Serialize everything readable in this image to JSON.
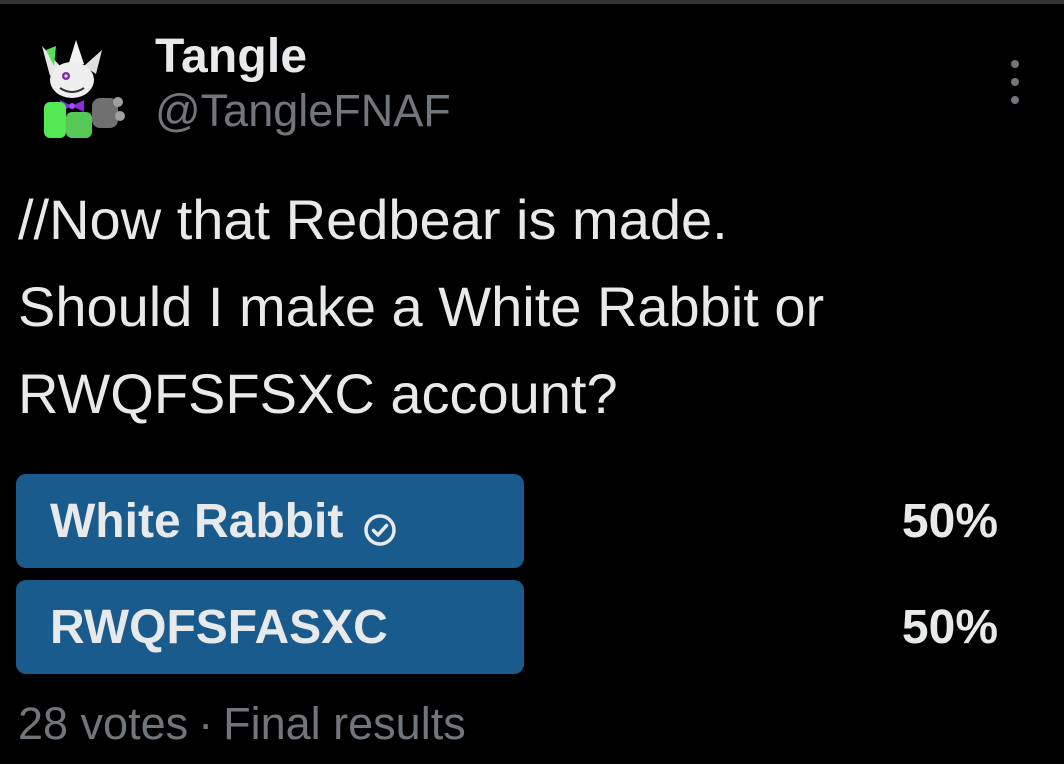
{
  "author": {
    "display_name": "Tangle",
    "handle": "@TangleFNAF",
    "avatar": "avatar-image"
  },
  "menu": {
    "icon": "more-vertical-icon"
  },
  "tweet": {
    "lines": [
      "//Now that Redbear is made.",
      "Should I make a White Rabbit or",
      "RWQFSFSXC account?"
    ]
  },
  "poll": {
    "options": [
      {
        "label": "White Rabbit",
        "percent": "50%",
        "fill": 0.5,
        "winner": true,
        "icon": "check-circle-icon"
      },
      {
        "label": "RWQFSFASXC",
        "percent": "50%",
        "fill": 0.5,
        "winner": false
      }
    ],
    "votes": "28 votes",
    "separator": "·",
    "status": "Final results"
  },
  "colors": {
    "background": "#000000",
    "text": "#e7e9ea",
    "muted": "#71767b",
    "poll_fill": "#1a5b8e"
  }
}
